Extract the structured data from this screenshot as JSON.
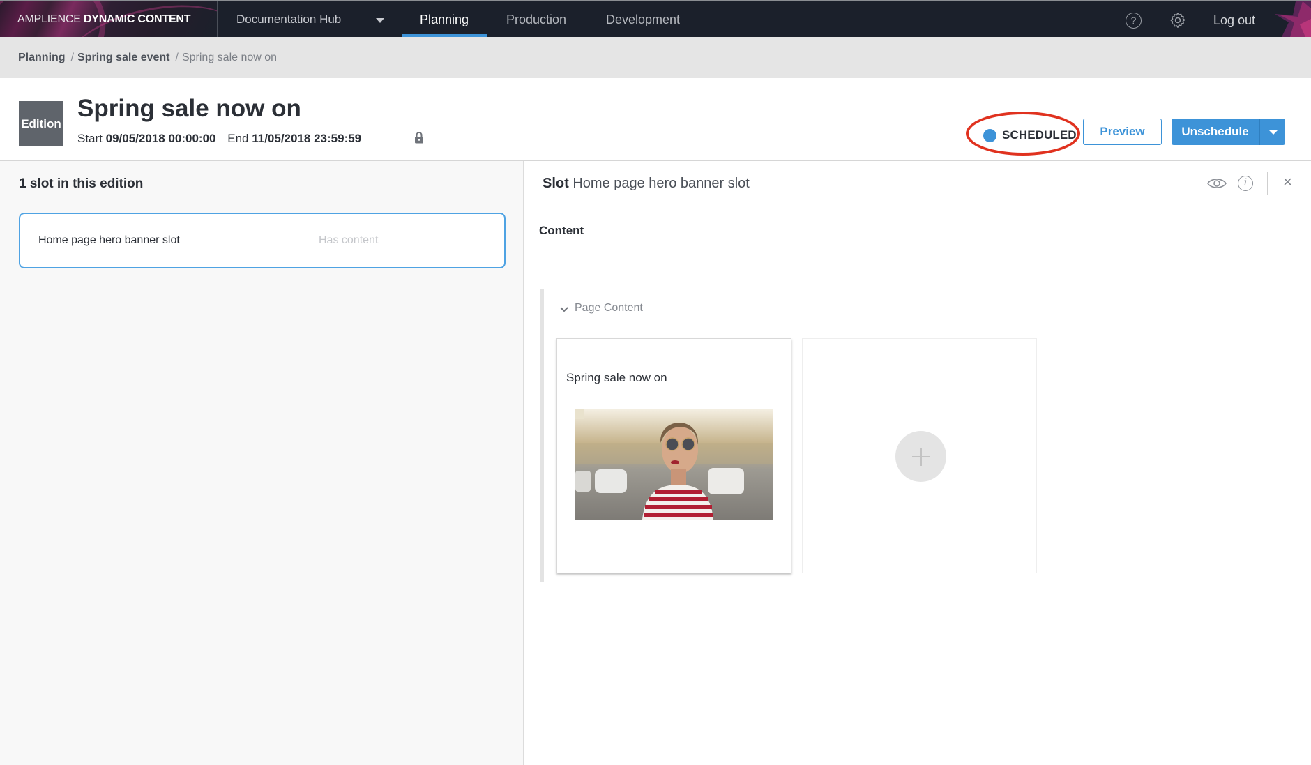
{
  "nav": {
    "brand_light": "AMPLIENCE",
    "brand_bold": "DYNAMIC CONTENT",
    "hub": "Documentation Hub",
    "tabs": [
      {
        "label": "Planning",
        "active": true
      },
      {
        "label": "Production",
        "active": false
      },
      {
        "label": "Development",
        "active": false
      }
    ],
    "help_glyph": "?",
    "logout": "Log out"
  },
  "breadcrumb": {
    "items": [
      "Planning",
      "Spring sale event",
      "Spring sale now on"
    ],
    "separator": "/"
  },
  "header": {
    "badge": "Edition",
    "title": "Spring sale now on",
    "start_label": "Start",
    "start_value": "09/05/2018 00:00:00",
    "end_label": "End",
    "end_value": "11/05/2018 23:59:59",
    "status": "SCHEDULED",
    "status_color": "#3d93d8",
    "highlight_color": "#e0321f",
    "preview_label": "Preview",
    "unschedule_label": "Unschedule"
  },
  "left": {
    "title": "1 slot in this edition",
    "slots": [
      {
        "name": "Home page hero banner slot",
        "status": "Has content"
      }
    ]
  },
  "right": {
    "title_prefix": "Slot",
    "title": "Home page hero banner slot",
    "content_label": "Content",
    "group_label": "Page Content",
    "cards": [
      {
        "title": "Spring sale now on",
        "has_image": true
      }
    ],
    "close_glyph": "×",
    "info_glyph": "i"
  },
  "colors": {
    "accent": "#3d93d8",
    "nav_bg": "#1b202b",
    "breadcrumb_bg": "#e5e5e5"
  }
}
